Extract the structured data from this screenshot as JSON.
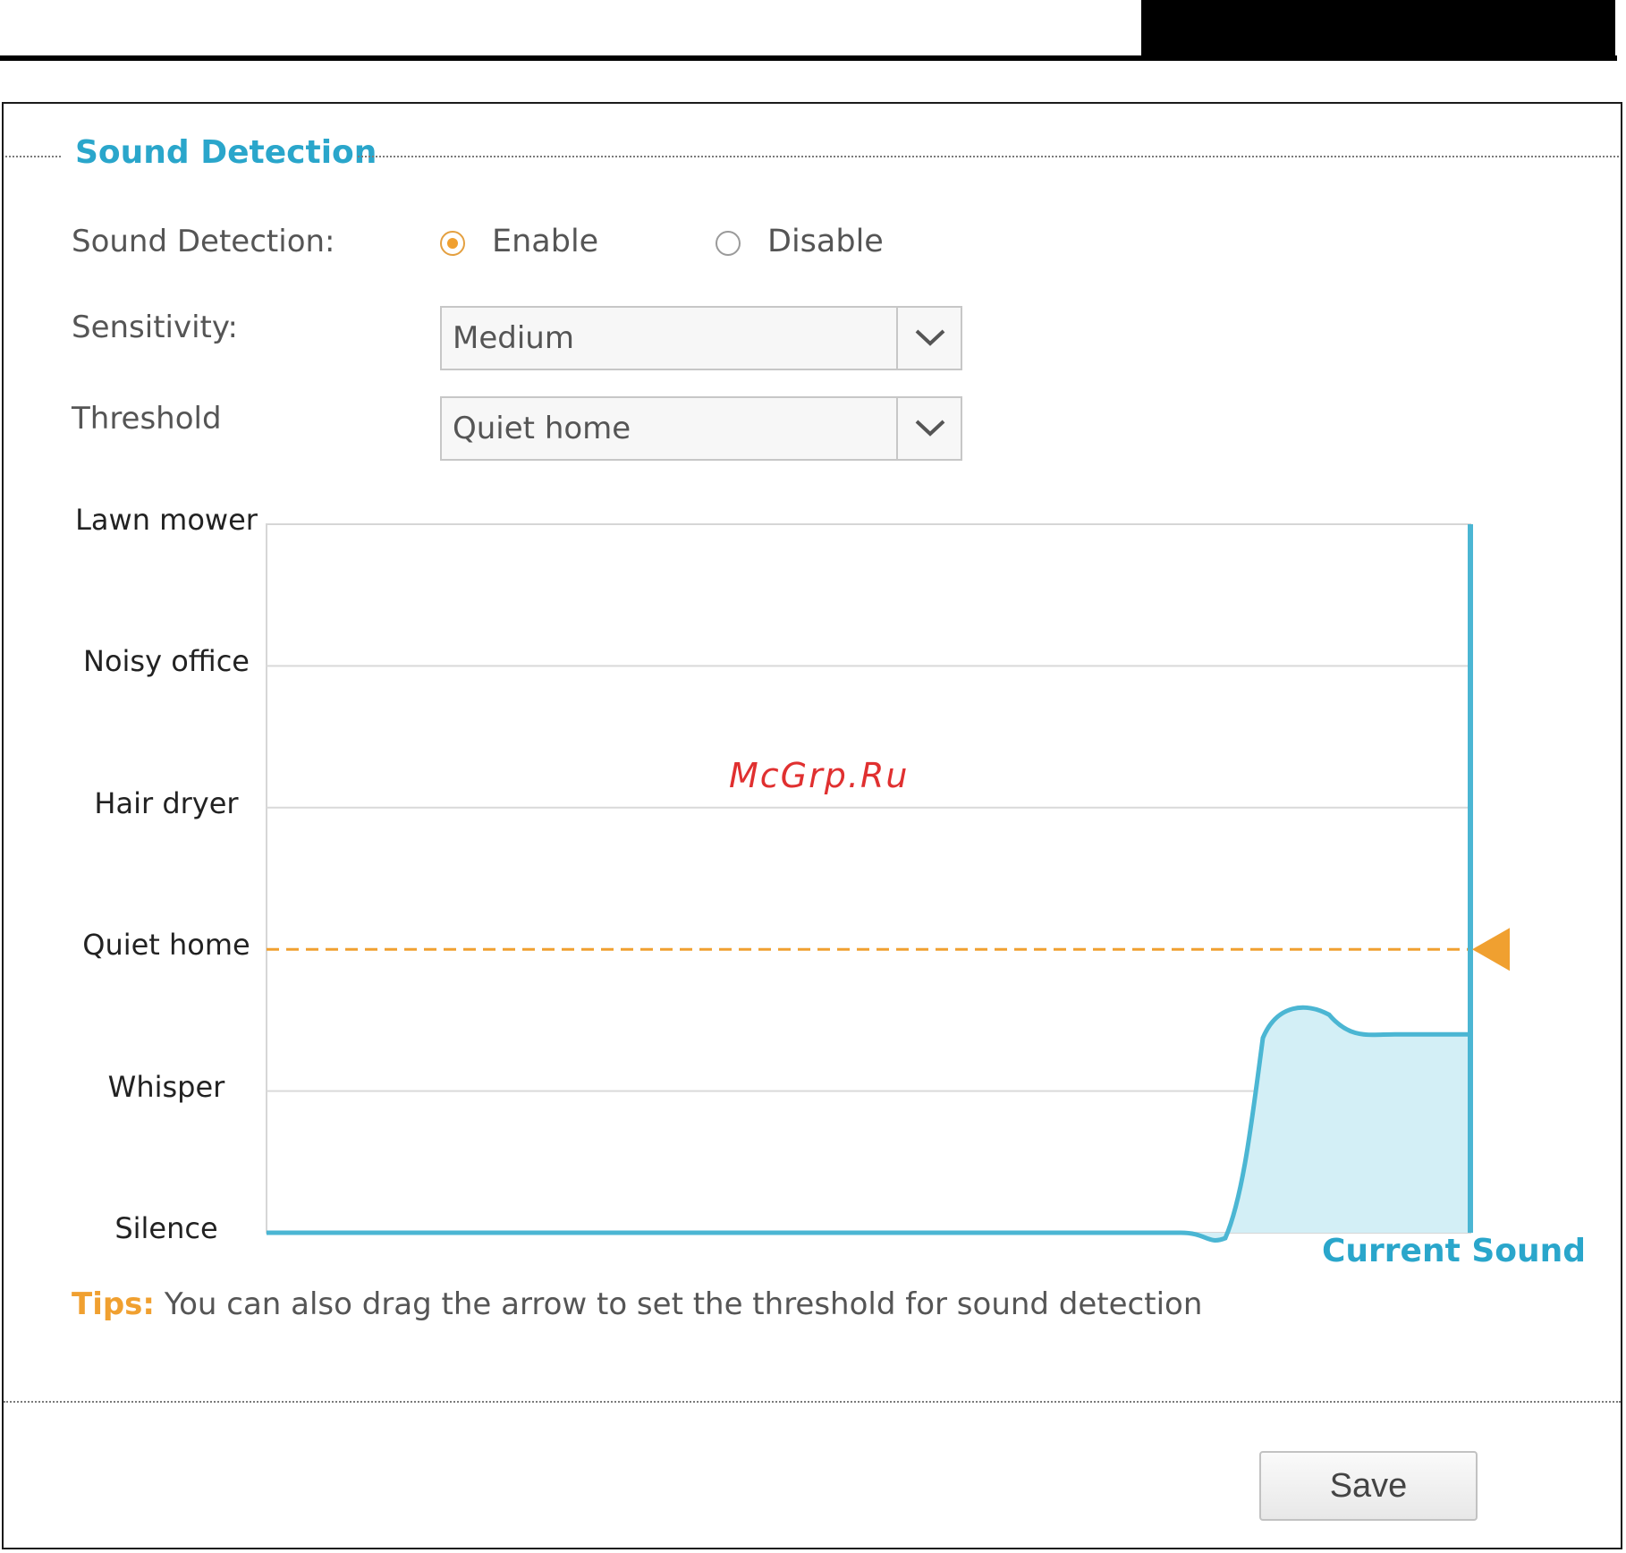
{
  "section": {
    "title": "Sound Detection"
  },
  "form": {
    "detection_label": "Sound Detection:",
    "enable_label": "Enable",
    "disable_label": "Disable",
    "detection_selected": "Enable",
    "sensitivity_label": "Sensitivity:",
    "sensitivity_value": "Medium",
    "threshold_label": "Threshold",
    "threshold_value": "Quiet home"
  },
  "chart_data": {
    "type": "area",
    "levels": [
      "Silence",
      "Whisper",
      "Quiet home",
      "Hair dryer",
      "Noisy office",
      "Lawn mower"
    ],
    "threshold": "Quiet home",
    "threshold_level_index": 2,
    "series_label": "Current Sound",
    "current_sound_level": 1.4,
    "grid": true,
    "colors": {
      "line": "#4bb6d3",
      "fill": "#d3eff6",
      "threshold": "#f0a030",
      "grid": "#d9d9d9"
    }
  },
  "watermark": "McGrp.Ru",
  "tips": {
    "key": "Tips:",
    "text": " You can also drag the arrow to set the threshold for sound detection"
  },
  "buttons": {
    "save_label": "Save"
  },
  "icons": {
    "dropdown": "chevron-down-icon",
    "threshold_handle": "triangle-left-icon"
  }
}
